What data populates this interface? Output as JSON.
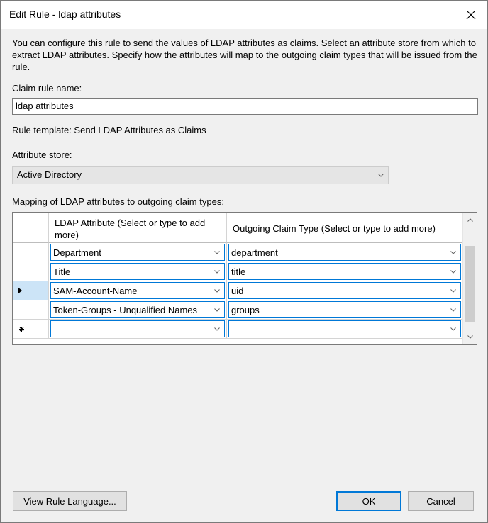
{
  "window": {
    "title": "Edit Rule - ldap attributes"
  },
  "description": "You can configure this rule to send the values of LDAP attributes as claims. Select an attribute store from which to extract LDAP attributes. Specify how the attributes will map to the outgoing claim types that will be issued from the rule.",
  "claim_rule_name": {
    "label": "Claim rule name:",
    "value": "ldap attributes"
  },
  "rule_template": "Rule template: Send LDAP Attributes as Claims",
  "attribute_store": {
    "label": "Attribute store:",
    "value": "Active Directory"
  },
  "mapping": {
    "label": "Mapping of LDAP attributes to outgoing claim types:",
    "columns": [
      "LDAP Attribute (Select or type to add more)",
      "Outgoing Claim Type (Select or type to add more)"
    ],
    "rows": [
      {
        "ldap": "Department",
        "claim": "department"
      },
      {
        "ldap": "Title",
        "claim": "title"
      },
      {
        "ldap": "SAM-Account-Name",
        "claim": "uid"
      },
      {
        "ldap": "Token-Groups - Unqualified Names",
        "claim": "groups"
      },
      {
        "ldap": "",
        "claim": ""
      }
    ],
    "selected_row": 2
  },
  "buttons": {
    "view_rule_language": "View Rule Language...",
    "ok": "OK",
    "cancel": "Cancel"
  },
  "icons": {
    "close": "close-icon",
    "dropdown": "chevron-down-icon",
    "row_pointer": "row-pointer-icon",
    "new_row": "new-row-icon"
  },
  "colors": {
    "accent": "#0078d7",
    "selected_row_header": "#cce4f7"
  }
}
